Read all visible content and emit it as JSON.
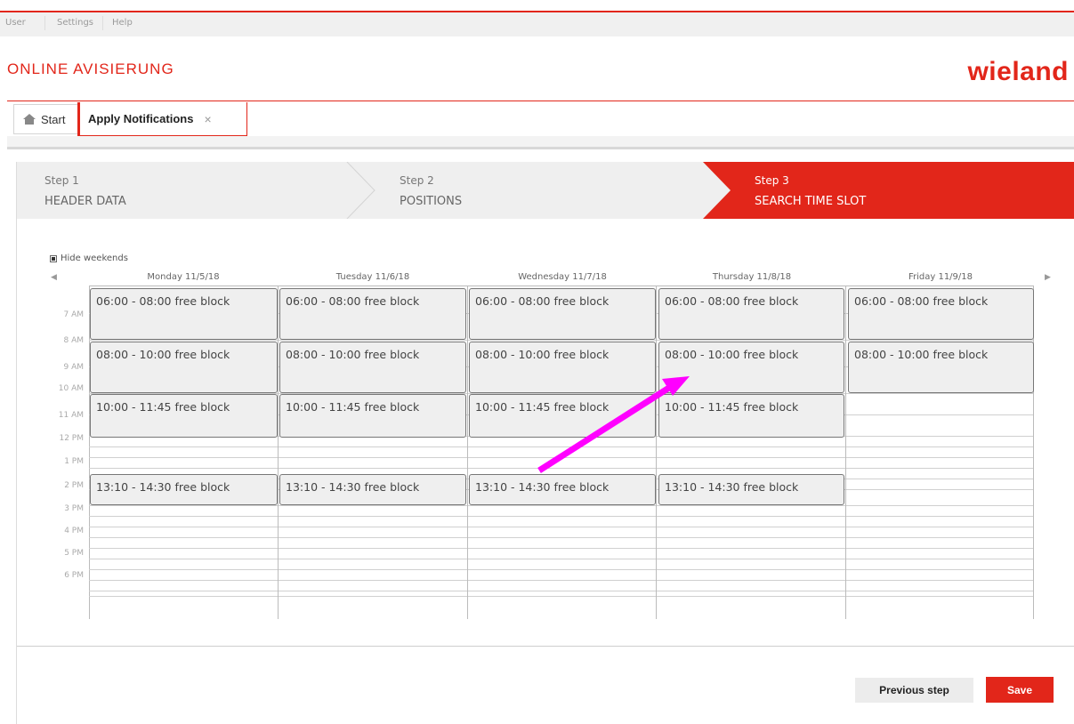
{
  "topbar": {
    "items": [
      "User",
      "Settings",
      "Help"
    ]
  },
  "header": {
    "app_title": "ONLINE AVISIERUNG",
    "brand": "wieland",
    "brand_color": "#e2261a"
  },
  "tabs": {
    "start_label": "Start",
    "apply_label": "Apply Notifications",
    "close_glyph": "×"
  },
  "steps": [
    {
      "num": "Step 1",
      "label": "HEADER DATA",
      "active": false
    },
    {
      "num": "Step 2",
      "label": "POSITIONS",
      "active": false
    },
    {
      "num": "Step 3",
      "label": "SEARCH TIME SLOT",
      "active": true
    }
  ],
  "calendar": {
    "hide_weekends_label": "Hide weekends",
    "hide_weekends_checked": true,
    "prev_glyph": "◀",
    "next_glyph": "▶",
    "days": [
      "Monday 11/5/18",
      "Tuesday 11/6/18",
      "Wednesday 11/7/18",
      "Thursday 11/8/18",
      "Friday 11/9/18"
    ],
    "hours": [
      "7 AM",
      "8 AM",
      "9 AM",
      "10 AM",
      "11 AM",
      "12 PM",
      "1 PM",
      "2 PM",
      "3 PM",
      "4 PM",
      "5 PM",
      "6 PM"
    ],
    "slot_labels": {
      "s0600": "06:00 - 08:00 free block",
      "s0800": "08:00 - 10:00 free block",
      "s1000": "10:00 - 11:45 free block",
      "s1310": "13:10 - 14:30 free block"
    }
  },
  "annotation": {
    "arrow_color": "#ff00ff"
  },
  "footer": {
    "previous_label": "Previous step",
    "save_label": "Save"
  }
}
